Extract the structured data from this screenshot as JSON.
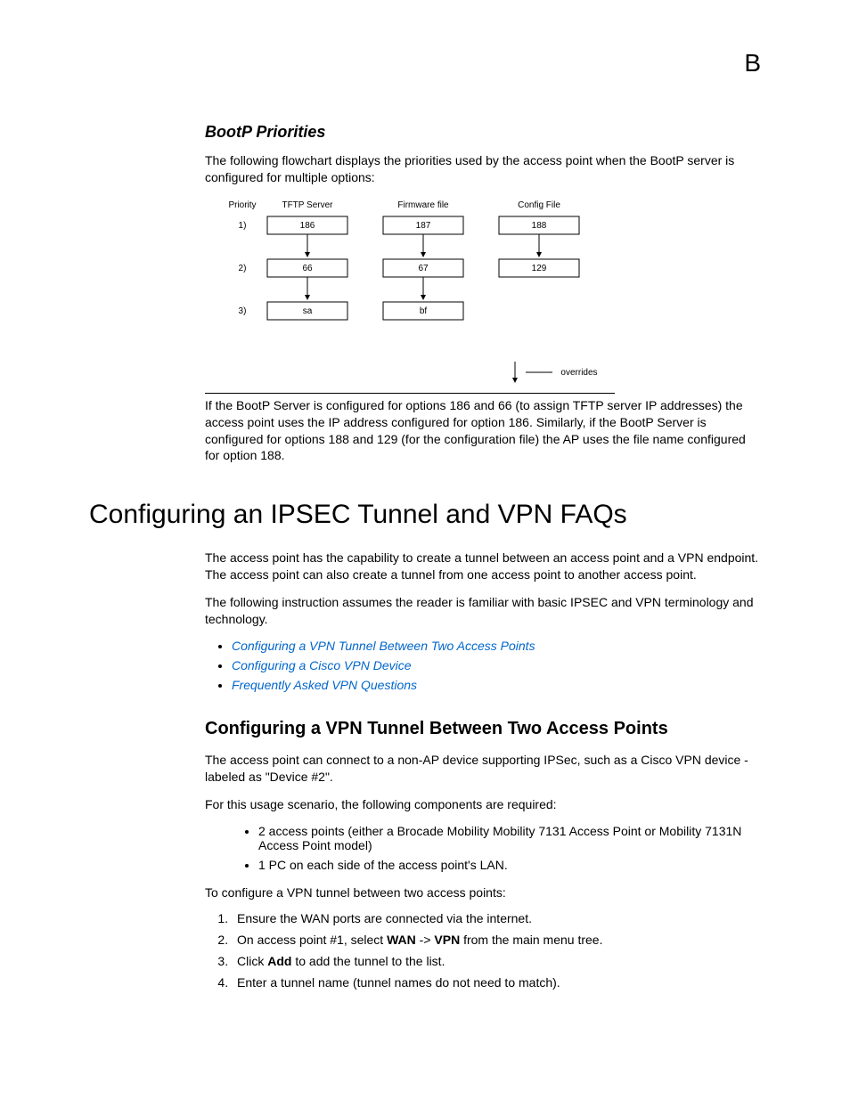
{
  "appendix_letter": "B",
  "section1": {
    "heading": "BootP Priorities",
    "intro": "The following flowchart displays the priorities used by the access point when the BootP server is configured for multiple options:",
    "flowchart": {
      "col_priority": "Priority",
      "col_tftp": "TFTP Server",
      "col_firmware": "Firmware file",
      "col_config": "Config File",
      "rows": [
        {
          "p": "1)",
          "a": "186",
          "b": "187",
          "c": "188"
        },
        {
          "p": "2)",
          "a": "66",
          "b": "67",
          "c": "129"
        },
        {
          "p": "3)",
          "a": "sa",
          "b": "bf",
          "c": ""
        }
      ],
      "overrides": "overrides"
    },
    "after": "If the BootP Server is configured for options 186 and 66 (to assign TFTP server IP addresses) the access point uses the IP address configured for option 186. Similarly, if the BootP Server is configured for options 188 and 129 (for the configuration file) the AP uses the file name configured for option 188."
  },
  "main_heading": "Configuring an IPSEC Tunnel and VPN FAQs",
  "intro2": "The access point has the capability to create a tunnel between an access point and a VPN endpoint. The access point can also create a tunnel from one access point to another access point.",
  "intro3": "The following instruction assumes the reader is familiar with basic IPSEC and VPN terminology and technology.",
  "links": [
    "Configuring a VPN Tunnel Between Two Access Points",
    "Configuring a Cisco VPN Device",
    "Frequently Asked VPN Questions"
  ],
  "sub_heading": "Configuring a VPN Tunnel Between Two Access Points",
  "sub_p1": "The access point can connect to a non-AP device supporting IPSec, such as a Cisco VPN device - labeled as \"Device #2\".",
  "sub_p2": "For this usage scenario, the following components are required:",
  "components": [
    "2 access points (either a Brocade Mobility Mobility 7131 Access Point or Mobility 7131N Access Point model)",
    "1 PC on each side of the access point's LAN."
  ],
  "sub_p3": "To configure a VPN tunnel between two access points:",
  "steps": {
    "s1": "Ensure the WAN ports are connected via the internet.",
    "s2_a": "On access point #1, select ",
    "s2_b": "WAN",
    "s2_c": " -> ",
    "s2_d": "VPN",
    "s2_e": " from the main menu tree.",
    "s3_a": "Click ",
    "s3_b": "Add",
    "s3_c": " to add the tunnel to the list.",
    "s4": "Enter a tunnel name (tunnel names do not need to match)."
  }
}
